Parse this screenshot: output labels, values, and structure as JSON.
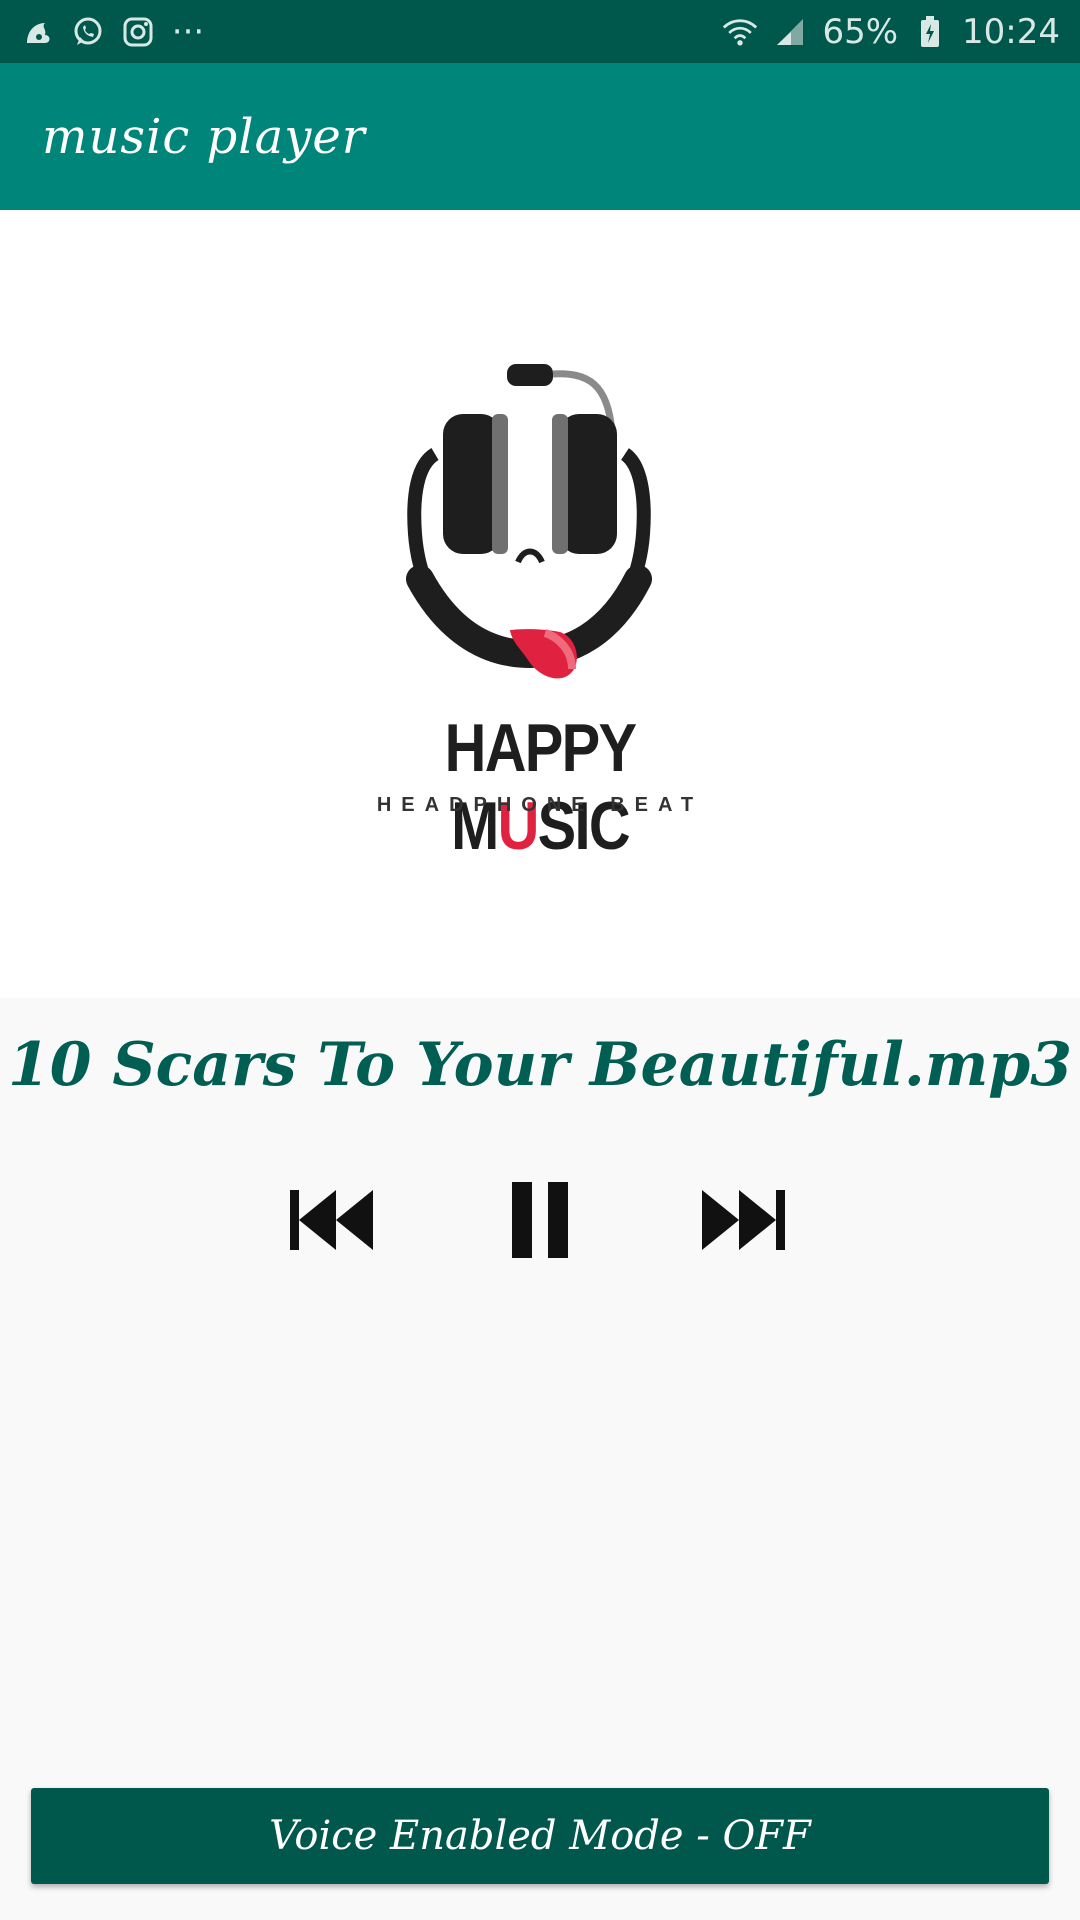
{
  "status_bar": {
    "icons_left": [
      "uc-browser-icon",
      "whatsapp-icon",
      "instagram-icon",
      "more-notifications-icon"
    ],
    "more": "···",
    "battery_percent": "65%",
    "time": "10:24"
  },
  "app_bar": {
    "title": "music player"
  },
  "album_art": {
    "brand": "HAPPY MUSIC",
    "brand_prefix": "HAPPY M",
    "brand_highlight": "U",
    "brand_suffix": "SIC",
    "tagline": "HEADPHONE BEAT"
  },
  "player": {
    "track_title": "10 Scars To Your Beautiful.mp3",
    "controls": [
      "previous-icon",
      "pause-icon",
      "next-icon"
    ]
  },
  "voice_mode": {
    "label": "Voice Enabled Mode - OFF"
  },
  "colors": {
    "status_bar": "#00574b",
    "app_bar": "#00857a",
    "accent_text": "#005e52",
    "logo_red": "#e0213f"
  }
}
